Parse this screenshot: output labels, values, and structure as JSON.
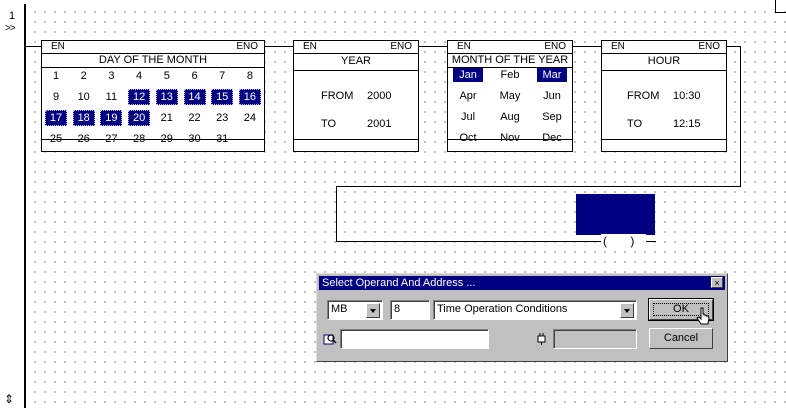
{
  "ladder": {
    "rung_number": "1",
    "rung_marker": ">>",
    "scroll_marker": "⇕"
  },
  "blocks": {
    "day_of_month": {
      "en": "EN",
      "eno": "ENO",
      "title": "DAY OF THE MONTH",
      "rows": [
        [
          "1",
          "2",
          "3",
          "4",
          "5",
          "6",
          "7",
          "8"
        ],
        [
          "9",
          "10",
          "11",
          "12",
          "13",
          "14",
          "15",
          "16"
        ],
        [
          "17",
          "18",
          "19",
          "20",
          "21",
          "22",
          "23",
          "24"
        ],
        [
          "25",
          "26",
          "27",
          "28",
          "29",
          "30",
          "31"
        ]
      ],
      "selected": [
        "12",
        "13",
        "14",
        "15",
        "16",
        "17",
        "18",
        "19",
        "20"
      ]
    },
    "year": {
      "en": "EN",
      "eno": "ENO",
      "title": "YEAR",
      "from_label": "FROM",
      "from_value": "2000",
      "to_label": "TO",
      "to_value": "2001"
    },
    "month_of_year": {
      "en": "EN",
      "eno": "ENO",
      "title": "MONTH OF THE YEAR",
      "rows": [
        [
          "Jan",
          "Feb",
          "Mar"
        ],
        [
          "Apr",
          "May",
          "Jun"
        ],
        [
          "Jul",
          "Aug",
          "Sep"
        ],
        [
          "Oct",
          "Nov",
          "Dec"
        ]
      ],
      "selected": [
        "Jan",
        "Mar"
      ]
    },
    "hour": {
      "en": "EN",
      "eno": "ENO",
      "title": "HOUR",
      "from_label": "FROM",
      "from_value": "10:30",
      "to_label": "TO",
      "to_value": "12:15"
    }
  },
  "coil": {
    "symbol": "( )"
  },
  "dialog": {
    "title": "Select Operand And Address ...",
    "close_glyph": "×",
    "operand_type": "MB",
    "address": "8",
    "description": "Time Operation Conditions",
    "search_value": "",
    "symbol_value": "",
    "ok_label": "OK",
    "cancel_label": "Cancel"
  },
  "colors": {
    "selection": "#000080",
    "dialog_face": "#c0c0c0",
    "title_bar": "#000080"
  }
}
